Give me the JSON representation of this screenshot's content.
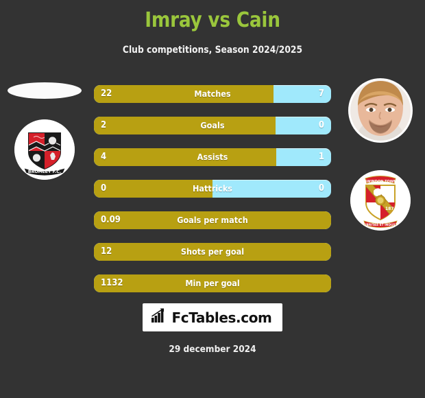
{
  "header": {
    "title": "Imray vs Cain",
    "subtitle": "Club competitions, Season 2024/2025",
    "title_color": "#9ac63c"
  },
  "colors": {
    "background": "#333333",
    "home_bar": "#b8a012",
    "away_bar": "#a0e9fc",
    "text": "#ffffff"
  },
  "left_player": {
    "name": "Imray",
    "photo": "missing-photo-placeholder",
    "club_crest": "bromley-fc-crest",
    "club_crest_text": "BROMLEY F.C."
  },
  "right_player": {
    "name": "Cain",
    "photo": "player-photo",
    "club_crest": "swindon-town-fc-crest",
    "club_crest_text": "1879"
  },
  "stats": [
    {
      "label": "Matches",
      "home": "22",
      "away": "7",
      "home_pct": 75.8,
      "two_sided": true
    },
    {
      "label": "Goals",
      "home": "2",
      "away": "0",
      "home_pct": 76.5,
      "two_sided": true
    },
    {
      "label": "Assists",
      "home": "4",
      "away": "1",
      "home_pct": 77.0,
      "two_sided": true
    },
    {
      "label": "Hattricks",
      "home": "0",
      "away": "0",
      "home_pct": 50.0,
      "two_sided": true
    },
    {
      "label": "Goals per match",
      "home": "0.09",
      "away": "",
      "home_pct": 100,
      "two_sided": false
    },
    {
      "label": "Shots per goal",
      "home": "12",
      "away": "",
      "home_pct": 100,
      "two_sided": false
    },
    {
      "label": "Min per goal",
      "home": "1132",
      "away": "",
      "home_pct": 100,
      "two_sided": false
    }
  ],
  "footer": {
    "brand": "FcTables.com",
    "brand_icon": "bar-chart-icon",
    "date": "29 december 2024"
  },
  "chart_data": {
    "type": "bar",
    "title": "Imray vs Cain",
    "subtitle": "Club competitions, Season 2024/2025",
    "categories": [
      "Matches",
      "Goals",
      "Assists",
      "Hattricks",
      "Goals per match",
      "Shots per goal",
      "Min per goal"
    ],
    "series": [
      {
        "name": "Imray",
        "values": [
          22,
          2,
          4,
          0,
          0.09,
          12,
          1132
        ]
      },
      {
        "name": "Cain",
        "values": [
          7,
          0,
          1,
          0,
          null,
          null,
          null
        ]
      }
    ],
    "orientation": "horizontal-split",
    "legend": "none",
    "grid": false
  }
}
